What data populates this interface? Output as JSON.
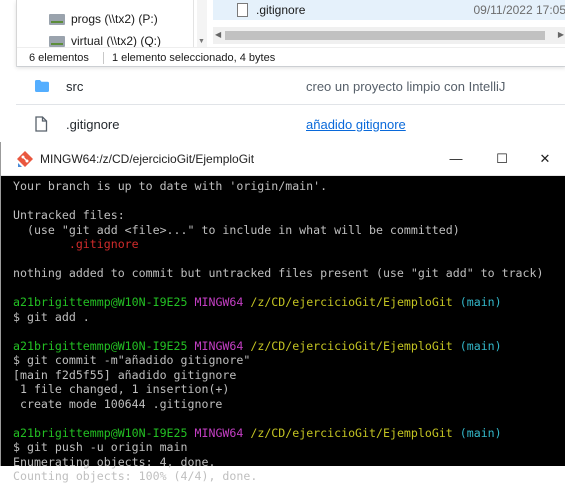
{
  "explorer": {
    "drives": [
      {
        "label": "progs (\\\\tx2) (P:)"
      },
      {
        "label": "virtual (\\\\tx2) (Q:)"
      }
    ],
    "selected_file": {
      "name": ".gitignore",
      "date": "09/11/2022 17:05"
    },
    "status": {
      "count": "6 elementos",
      "selection": "1 elemento seleccionado, 4 bytes"
    }
  },
  "repo_files": [
    {
      "name": "src",
      "type": "folder",
      "message": "creo un proyecto limpio con IntelliJ",
      "message_link": false
    },
    {
      "name": ".gitignore",
      "type": "file",
      "message": "añadido gitignore",
      "message_link": true
    }
  ],
  "terminal": {
    "title": "MINGW64:/z/CD/ejercicioGit/EjemploGit",
    "controls": {
      "minimize": "—",
      "maximize": "☐",
      "close": "✕"
    },
    "lines": [
      [
        {
          "t": "Your branch is up to date with 'origin/main'."
        }
      ],
      [
        {
          "t": ""
        }
      ],
      [
        {
          "t": "Untracked files:"
        }
      ],
      [
        {
          "t": "  (use \"git add <file>...\" to include in what will be committed)"
        }
      ],
      [
        {
          "t": "        "
        },
        {
          "t": ".gitignore",
          "c": "red"
        }
      ],
      [
        {
          "t": ""
        }
      ],
      [
        {
          "t": "nothing added to commit but untracked files present (use \"git add\" to track)"
        }
      ],
      [
        {
          "t": ""
        }
      ],
      [
        {
          "t": "a21brigittemmp@W10N-I9E25",
          "c": "green"
        },
        {
          "t": " "
        },
        {
          "t": "MINGW64",
          "c": "magenta"
        },
        {
          "t": " "
        },
        {
          "t": "/z/CD/ejercicioGit/EjemploGit",
          "c": "yellow"
        },
        {
          "t": " "
        },
        {
          "t": "(main)",
          "c": "cyan"
        }
      ],
      [
        {
          "t": "$ git add ."
        }
      ],
      [
        {
          "t": ""
        }
      ],
      [
        {
          "t": "a21brigittemmp@W10N-I9E25",
          "c": "green"
        },
        {
          "t": " "
        },
        {
          "t": "MINGW64",
          "c": "magenta"
        },
        {
          "t": " "
        },
        {
          "t": "/z/CD/ejercicioGit/EjemploGit",
          "c": "yellow"
        },
        {
          "t": " "
        },
        {
          "t": "(main)",
          "c": "cyan"
        }
      ],
      [
        {
          "t": "$ git commit -m\"añadido gitignore\""
        }
      ],
      [
        {
          "t": "[main f2d5f55] añadido gitignore"
        }
      ],
      [
        {
          "t": " 1 file changed, 1 insertion(+)"
        }
      ],
      [
        {
          "t": " create mode 100644 .gitignore"
        }
      ],
      [
        {
          "t": ""
        }
      ],
      [
        {
          "t": "a21brigittemmp@W10N-I9E25",
          "c": "green"
        },
        {
          "t": " "
        },
        {
          "t": "MINGW64",
          "c": "magenta"
        },
        {
          "t": " "
        },
        {
          "t": "/z/CD/ejercicioGit/EjemploGit",
          "c": "yellow"
        },
        {
          "t": " "
        },
        {
          "t": "(main)",
          "c": "cyan"
        }
      ],
      [
        {
          "t": "$ git push -u origin main"
        }
      ],
      [
        {
          "t": "Enumerating objects: 4, done."
        }
      ],
      [
        {
          "t": "Counting objects: 100% (4/4), done."
        }
      ]
    ]
  },
  "colors": {
    "terminal_bg": "#000000",
    "prompt_user": "#23c023",
    "prompt_shell": "#c43fc4",
    "prompt_path": "#c3c322",
    "prompt_branch": "#33b7c9",
    "untracked_file": "#d12b2b",
    "link": "#0969da"
  }
}
